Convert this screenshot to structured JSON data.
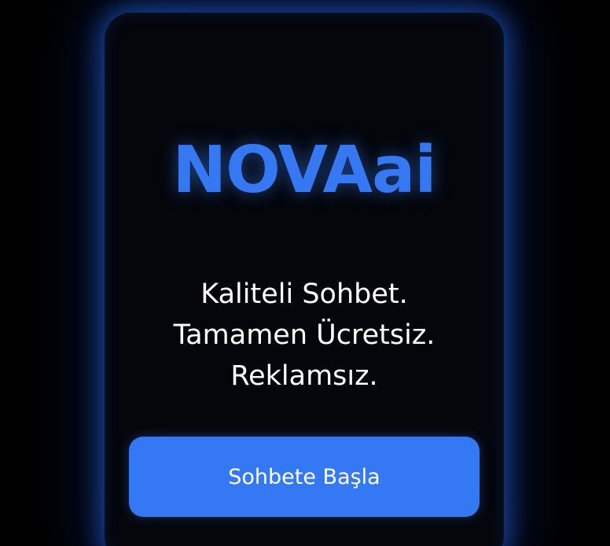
{
  "app": {
    "logo_text": "NOVAai"
  },
  "tagline": {
    "line1": "Kaliteli Sohbet.",
    "line2": "Tamamen Ücretsiz.",
    "line3": "Reklamsız."
  },
  "cta": {
    "label": "Sohbete Başla"
  },
  "colors": {
    "accent": "#3578f2",
    "button": "#3479f3",
    "background": "#000000",
    "card": "#04060b"
  }
}
